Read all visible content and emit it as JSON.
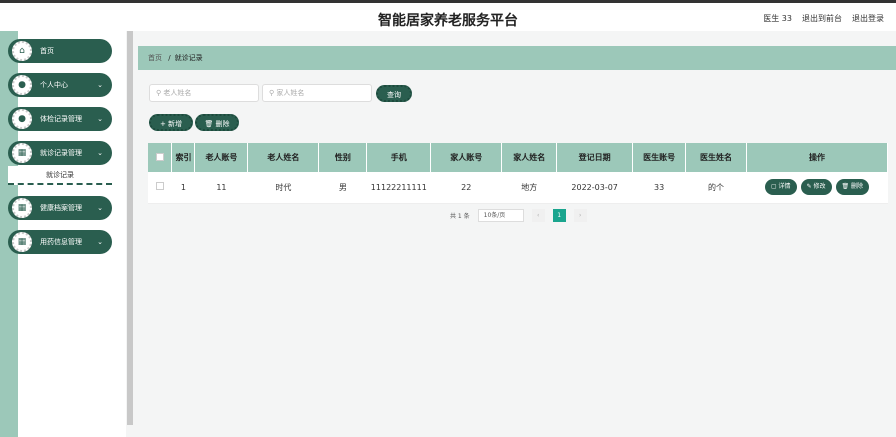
{
  "header": {
    "title": "智能居家养老服务平台",
    "user": "医生 33",
    "front": "退出到前台",
    "logout": "退出登录"
  },
  "menu": [
    {
      "label": "首页",
      "icon": "home-icon",
      "glyph": "⌂"
    },
    {
      "label": "个人中心",
      "icon": "user-icon",
      "glyph": "●"
    },
    {
      "label": "体检记录管理",
      "icon": "user-icon",
      "glyph": "●"
    },
    {
      "label": "就诊记录管理",
      "icon": "grid-icon",
      "glyph": "▦"
    },
    {
      "label": "健康档案管理",
      "icon": "grid-icon",
      "glyph": "▦"
    },
    {
      "label": "用药信息管理",
      "icon": "grid-icon",
      "glyph": "▦"
    }
  ],
  "submenu": "就诊记录",
  "breadcrumb": {
    "home": "首页",
    "sep": "/",
    "current": "就诊记录"
  },
  "search": {
    "elder_placeholder": "老人姓名",
    "family_placeholder": "家人姓名",
    "query": "查询"
  },
  "actions": {
    "add": "+ 新增",
    "delete": "🗑 删除"
  },
  "table": {
    "headers": [
      "索引",
      "老人账号",
      "老人姓名",
      "性别",
      "手机",
      "家人账号",
      "家人姓名",
      "登记日期",
      "医生账号",
      "医生姓名",
      "操作"
    ],
    "rows": [
      [
        "1",
        "11",
        "时代",
        "男",
        "11122211111",
        "22",
        "地方",
        "2022-03-07",
        "33",
        "的个"
      ]
    ],
    "ops": [
      "▢ 详情",
      "✎ 修改",
      "🗑 删除"
    ]
  },
  "pagination": {
    "total": "共 1 条",
    "size": "10条/页",
    "page": "1",
    "prev": "‹",
    "next": "›"
  }
}
